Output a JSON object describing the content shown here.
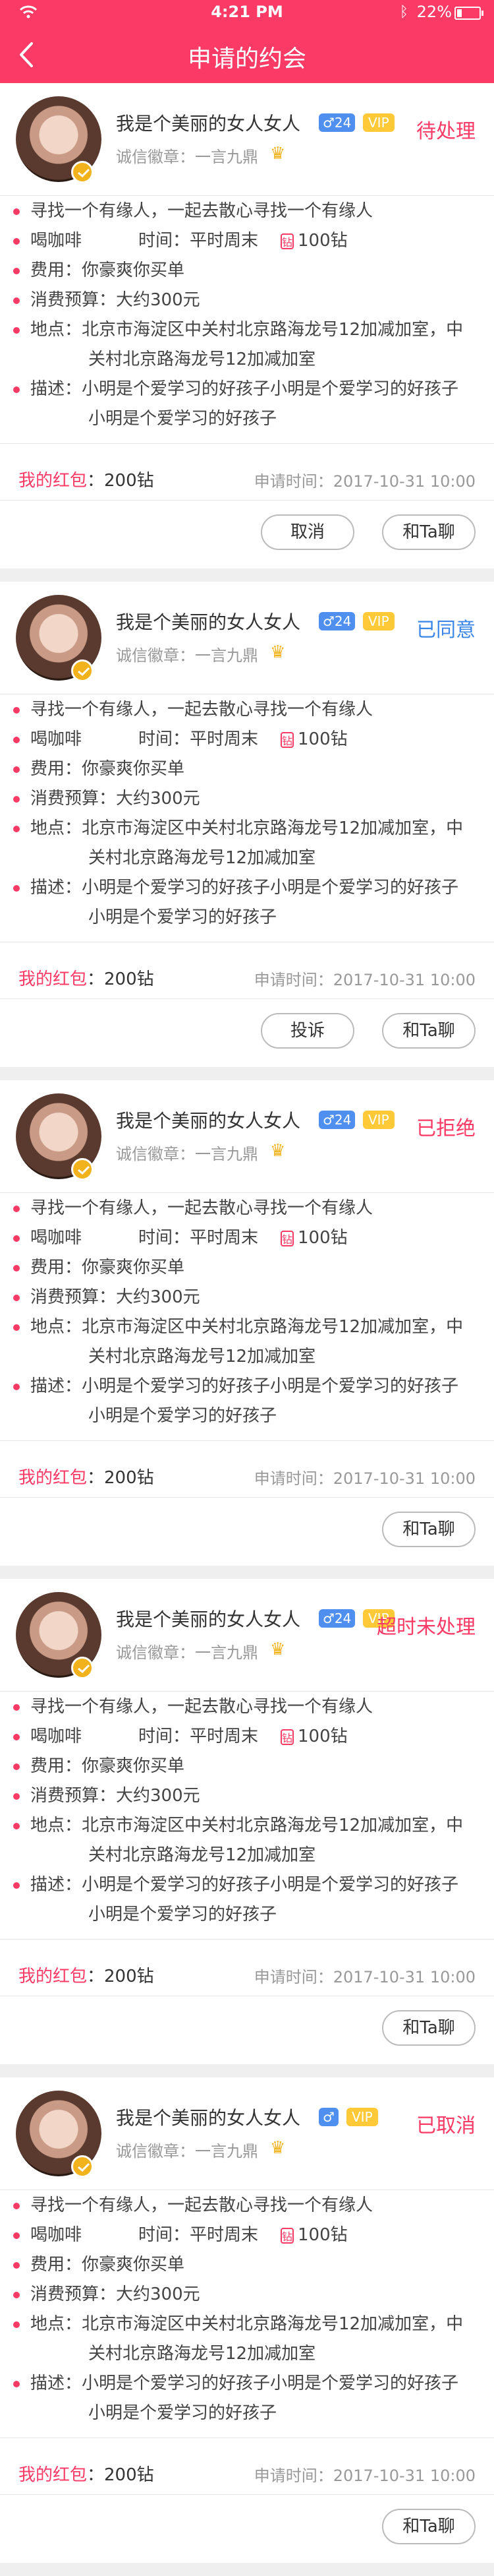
{
  "statusbar": {
    "time": "4:21 PM",
    "battery": "22%",
    "battery_level": 0.22
  },
  "header": {
    "title": "申请的约会"
  },
  "colors": {
    "brand": "#fb3a66",
    "approved": "#3b86e8",
    "status_red": "#fb3a66"
  },
  "cards": [
    {
      "name": "我是个美丽的女人女人",
      "gender_tag": "♂24",
      "vip": "VIP",
      "status": "待处理",
      "status_color": "#fb3a66",
      "credit": "诚信徽章：一言九鼎",
      "line1": "寻找一个有缘人，一起去散心寻找一个有缘人",
      "activity": "喝咖啡",
      "time": "时间：平时周末",
      "diamonds": "100钻",
      "cost": "费用：你豪爽你买单",
      "budget": "消费预算：大约300元",
      "place_label": "地点：",
      "place": "北京市海淀区中关村北京路海龙号12加减加室，中",
      "place2": "关村北京路海龙号12加减加室",
      "desc_label": "描述：",
      "desc": "小明是个爱学习的好孩子小明是个爱学习的好孩子",
      "desc2": "小明是个爱学习的好孩子",
      "redpacket_label": "我的红包",
      "redpacket_value": "：200钻",
      "apply_time": "申请时间：2017-10-31  10:00",
      "buttons": [
        "取消",
        "和Ta聊"
      ]
    },
    {
      "name": "我是个美丽的女人女人",
      "gender_tag": "♂24",
      "vip": "VIP",
      "status": "已同意",
      "status_color": "#3b86e8",
      "credit": "诚信徽章：一言九鼎",
      "line1": "寻找一个有缘人，一起去散心寻找一个有缘人",
      "activity": "喝咖啡",
      "time": "时间：平时周末",
      "diamonds": "100钻",
      "cost": "费用：你豪爽你买单",
      "budget": "消费预算：大约300元",
      "place_label": "地点：",
      "place": "北京市海淀区中关村北京路海龙号12加减加室，中",
      "place2": "关村北京路海龙号12加减加室",
      "desc_label": "描述：",
      "desc": "小明是个爱学习的好孩子小明是个爱学习的好孩子",
      "desc2": "小明是个爱学习的好孩子",
      "redpacket_label": "我的红包",
      "redpacket_value": "：200钻",
      "apply_time": "申请时间：2017-10-31  10:00",
      "buttons": [
        "投诉",
        "和Ta聊"
      ]
    },
    {
      "name": "我是个美丽的女人女人",
      "gender_tag": "♂24",
      "vip": "VIP",
      "status": "已拒绝",
      "status_color": "#fb3a66",
      "credit": "诚信徽章：一言九鼎",
      "line1": "寻找一个有缘人，一起去散心寻找一个有缘人",
      "activity": "喝咖啡",
      "time": "时间：平时周末",
      "diamonds": "100钻",
      "cost": "费用：你豪爽你买单",
      "budget": "消费预算：大约300元",
      "place_label": "地点：",
      "place": "北京市海淀区中关村北京路海龙号12加减加室，中",
      "place2": "关村北京路海龙号12加减加室",
      "desc_label": "描述：",
      "desc": "小明是个爱学习的好孩子小明是个爱学习的好孩子",
      "desc2": "小明是个爱学习的好孩子",
      "redpacket_label": "我的红包",
      "redpacket_value": "：200钻",
      "apply_time": "申请时间：2017-10-31  10:00",
      "buttons": [
        "和Ta聊"
      ]
    },
    {
      "name": "我是个美丽的女人女人",
      "gender_tag": "♂24",
      "vip": "VIP",
      "status": "超时未处理",
      "status_color": "#fb3a66",
      "credit": "诚信徽章：一言九鼎",
      "line1": "寻找一个有缘人，一起去散心寻找一个有缘人",
      "activity": "喝咖啡",
      "time": "时间：平时周末",
      "diamonds": "100钻",
      "cost": "费用：你豪爽你买单",
      "budget": "消费预算：大约300元",
      "place_label": "地点：",
      "place": "北京市海淀区中关村北京路海龙号12加减加室，中",
      "place2": "关村北京路海龙号12加减加室",
      "desc_label": "描述：",
      "desc": "小明是个爱学习的好孩子小明是个爱学习的好孩子",
      "desc2": "小明是个爱学习的好孩子",
      "redpacket_label": "我的红包",
      "redpacket_value": "：200钻",
      "apply_time": "申请时间：2017-10-31  10:00",
      "buttons": [
        "和Ta聊"
      ]
    },
    {
      "name": "我是个美丽的女人女人",
      "gender_tag": "♂",
      "vip": "VIP",
      "status": "已取消",
      "status_color": "#fb3a66",
      "credit": "诚信徽章：一言九鼎",
      "line1": "寻找一个有缘人，一起去散心寻找一个有缘人",
      "activity": "喝咖啡",
      "time": "时间：平时周末",
      "diamonds": "100钻",
      "cost": "费用：你豪爽你买单",
      "budget": "消费预算：大约300元",
      "place_label": "地点：",
      "place": "北京市海淀区中关村北京路海龙号12加减加室，中",
      "place2": "关村北京路海龙号12加减加室",
      "desc_label": "描述：",
      "desc": "小明是个爱学习的好孩子小明是个爱学习的好孩子",
      "desc2": "小明是个爱学习的好孩子",
      "redpacket_label": "我的红包",
      "redpacket_value": "：200钻",
      "apply_time": "申请时间：2017-10-31  10:00",
      "buttons": [
        "和Ta聊"
      ]
    }
  ]
}
